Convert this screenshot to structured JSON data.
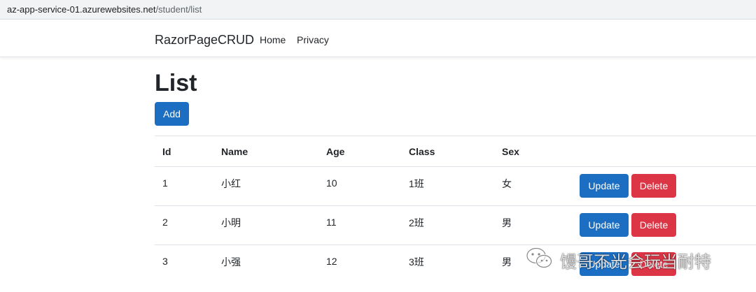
{
  "browser": {
    "url_host": "az-app-service-01.azurewebsites.net",
    "url_path": "/student/list"
  },
  "navbar": {
    "brand": "RazorPageCRUD",
    "links": [
      "Home",
      "Privacy"
    ]
  },
  "main": {
    "title": "List",
    "add_label": "Add",
    "table": {
      "headers": [
        "Id",
        "Name",
        "Age",
        "Class",
        "Sex"
      ],
      "rows": [
        {
          "id": "1",
          "name": "小红",
          "age": "10",
          "class": "1班",
          "sex": "女",
          "update": "Update",
          "delete": "Delete"
        },
        {
          "id": "2",
          "name": "小明",
          "age": "11",
          "class": "2班",
          "sex": "男",
          "update": "Update",
          "delete": "Delete"
        },
        {
          "id": "3",
          "name": "小强",
          "age": "12",
          "class": "3班",
          "sex": "男",
          "update": "Update",
          "delete": "Delete"
        }
      ]
    }
  },
  "watermark": {
    "text": "馒哥不光会玩当耐特",
    "icon": "wechat-icon"
  },
  "colors": {
    "primary": "#1b6ec2",
    "danger": "#dc3545"
  }
}
